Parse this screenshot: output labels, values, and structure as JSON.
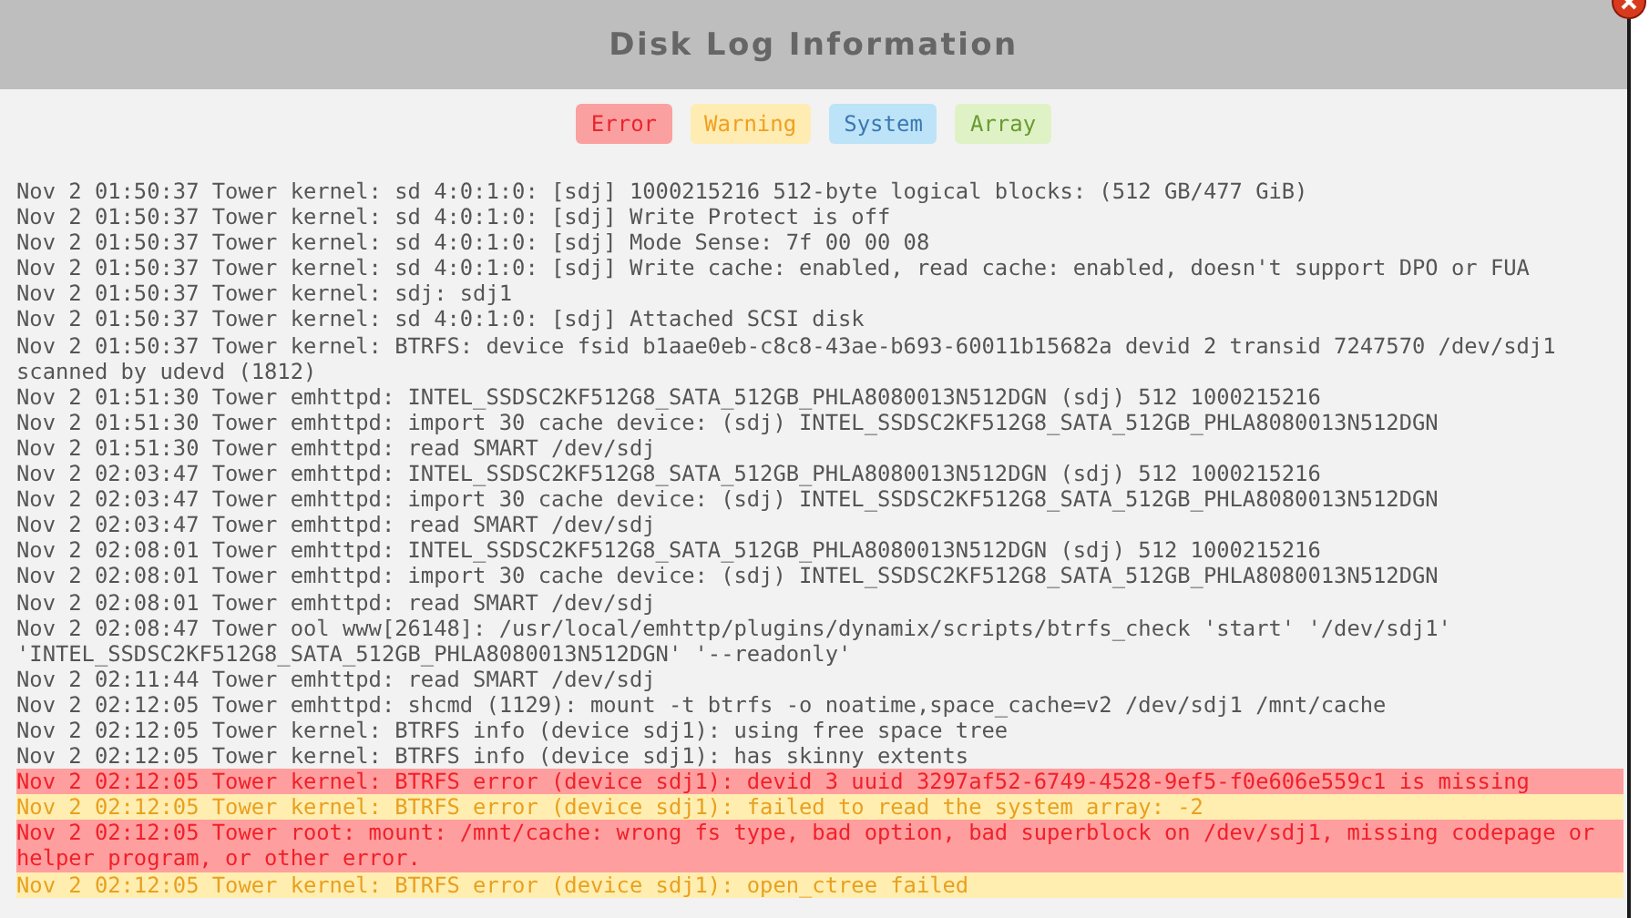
{
  "dialog": {
    "title": "Disk Log Information"
  },
  "filters": [
    {
      "label": "Error",
      "kind": "error"
    },
    {
      "label": "Warning",
      "kind": "warning"
    },
    {
      "label": "System",
      "kind": "system"
    },
    {
      "label": "Array",
      "kind": "array"
    }
  ],
  "log": [
    {
      "kind": "normal",
      "text": "Nov 2 01:50:37 Tower kernel: sd 4:0:1:0: [sdj] 1000215216 512-byte logical blocks: (512 GB/477 GiB)"
    },
    {
      "kind": "normal",
      "text": "Nov 2 01:50:37 Tower kernel: sd 4:0:1:0: [sdj] Write Protect is off"
    },
    {
      "kind": "normal",
      "text": "Nov 2 01:50:37 Tower kernel: sd 4:0:1:0: [sdj] Mode Sense: 7f 00 00 08"
    },
    {
      "kind": "normal",
      "text": "Nov 2 01:50:37 Tower kernel: sd 4:0:1:0: [sdj] Write cache: enabled, read cache: enabled, doesn't support DPO or FUA"
    },
    {
      "kind": "normal",
      "text": "Nov 2 01:50:37 Tower kernel: sdj: sdj1"
    },
    {
      "kind": "normal",
      "text": "Nov 2 01:50:37 Tower kernel: sd 4:0:1:0: [sdj] Attached SCSI disk"
    },
    {
      "kind": "normal",
      "text": "Nov 2 01:50:37 Tower kernel: BTRFS: device fsid b1aae0eb-c8c8-43ae-b693-60011b15682a devid 2 transid 7247570 /dev/sdj1 scanned by udevd (1812)"
    },
    {
      "kind": "normal",
      "text": "Nov 2 01:51:30 Tower emhttpd: INTEL_SSDSC2KF512G8_SATA_512GB_PHLA8080013N512DGN (sdj) 512 1000215216"
    },
    {
      "kind": "normal",
      "text": "Nov 2 01:51:30 Tower emhttpd: import 30 cache device: (sdj) INTEL_SSDSC2KF512G8_SATA_512GB_PHLA8080013N512DGN"
    },
    {
      "kind": "normal",
      "text": "Nov 2 01:51:30 Tower emhttpd: read SMART /dev/sdj"
    },
    {
      "kind": "normal",
      "text": "Nov 2 02:03:47 Tower emhttpd: INTEL_SSDSC2KF512G8_SATA_512GB_PHLA8080013N512DGN (sdj) 512 1000215216"
    },
    {
      "kind": "normal",
      "text": "Nov 2 02:03:47 Tower emhttpd: import 30 cache device: (sdj) INTEL_SSDSC2KF512G8_SATA_512GB_PHLA8080013N512DGN"
    },
    {
      "kind": "normal",
      "text": "Nov 2 02:03:47 Tower emhttpd: read SMART /dev/sdj"
    },
    {
      "kind": "normal",
      "text": "Nov 2 02:08:01 Tower emhttpd: INTEL_SSDSC2KF512G8_SATA_512GB_PHLA8080013N512DGN (sdj) 512 1000215216"
    },
    {
      "kind": "normal",
      "text": "Nov 2 02:08:01 Tower emhttpd: import 30 cache device: (sdj) INTEL_SSDSC2KF512G8_SATA_512GB_PHLA8080013N512DGN"
    },
    {
      "kind": "normal",
      "text": "Nov 2 02:08:01 Tower emhttpd: read SMART /dev/sdj"
    },
    {
      "kind": "normal",
      "text": "Nov 2 02:08:47 Tower ool www[26148]: /usr/local/emhttp/plugins/dynamix/scripts/btrfs_check 'start' '/dev/sdj1' 'INTEL_SSDSC2KF512G8_SATA_512GB_PHLA8080013N512DGN' '--readonly'"
    },
    {
      "kind": "normal",
      "text": "Nov 2 02:11:44 Tower emhttpd: read SMART /dev/sdj"
    },
    {
      "kind": "normal",
      "text": "Nov 2 02:12:05 Tower emhttpd: shcmd (1129): mount -t btrfs -o noatime,space_cache=v2 /dev/sdj1 /mnt/cache"
    },
    {
      "kind": "normal",
      "text": "Nov 2 02:12:05 Tower kernel: BTRFS info (device sdj1): using free space tree"
    },
    {
      "kind": "normal",
      "text": "Nov 2 02:12:05 Tower kernel: BTRFS info (device sdj1): has skinny extents"
    },
    {
      "kind": "error",
      "text": "Nov 2 02:12:05 Tower kernel: BTRFS error (device sdj1): devid 3 uuid 3297af52-6749-4528-9ef5-f0e606e559c1 is missing"
    },
    {
      "kind": "warning",
      "text": "Nov 2 02:12:05 Tower kernel: BTRFS error (device sdj1): failed to read the system array: -2"
    },
    {
      "kind": "error",
      "text": "Nov 2 02:12:05 Tower root: mount: /mnt/cache: wrong fs type, bad option, bad superblock on /dev/sdj1, missing codepage or helper program, or other error."
    },
    {
      "kind": "warning",
      "text": "Nov 2 02:12:05 Tower kernel: BTRFS error (device sdj1): open_ctree failed"
    }
  ]
}
